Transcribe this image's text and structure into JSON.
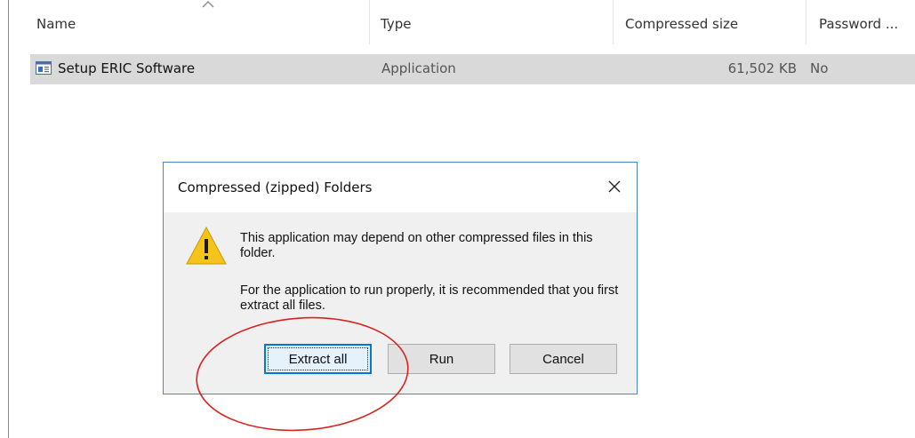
{
  "explorer": {
    "columns": [
      {
        "label": "Name"
      },
      {
        "label": "Type"
      },
      {
        "label": "Compressed size"
      },
      {
        "label": "Password ..."
      }
    ],
    "files": [
      {
        "name": "Setup ERIC Software",
        "type": "Application",
        "compressed_size": "61,502 KB",
        "password": "No",
        "icon": "application-window-icon"
      }
    ],
    "sort_icon": "sort-ascending-icon"
  },
  "dialog": {
    "title": "Compressed (zipped) Folders",
    "close_icon": "close-icon",
    "warning_icon": "warning-triangle-icon",
    "message_1": "This application may depend on other compressed files in this folder.",
    "message_2": "For the application to run properly, it is recommended that you first extract all files.",
    "buttons": {
      "extract_all": "Extract all",
      "run": "Run",
      "cancel": "Cancel"
    }
  },
  "colors": {
    "selection_row": "#d9d9d9",
    "dialog_border": "#4a86c8",
    "default_button_border": "#0078d7",
    "annotation_ellipse": "#d9221e",
    "warning_fill": "#f5c31a"
  }
}
